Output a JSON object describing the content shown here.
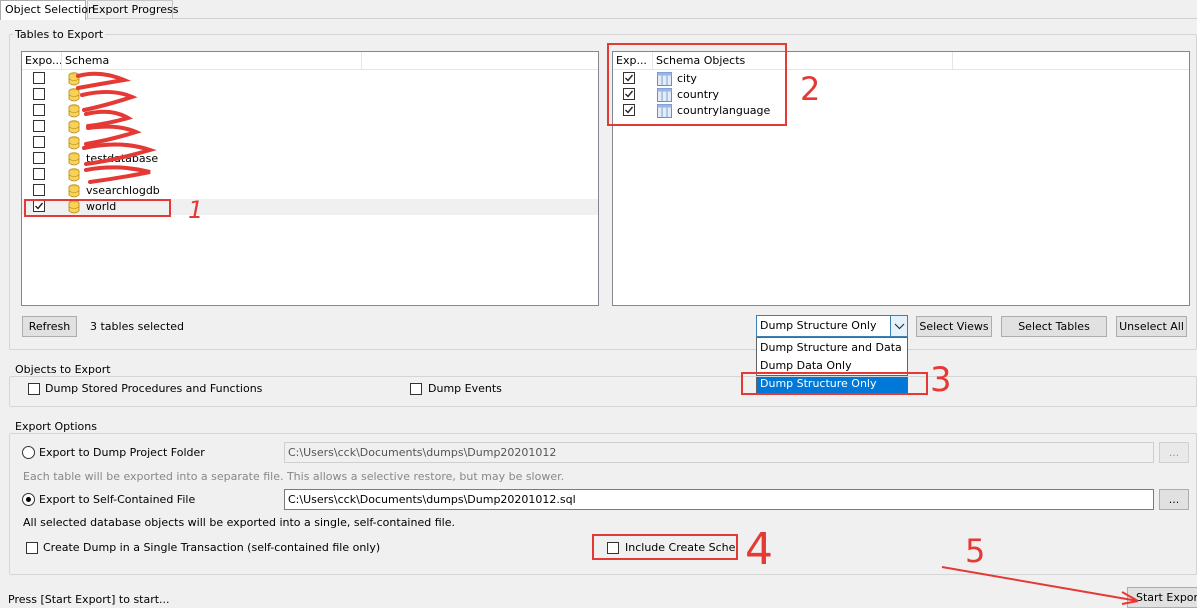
{
  "tabs": [
    {
      "label": "Object Selection",
      "active": true
    },
    {
      "label": "Export Progress",
      "active": false
    }
  ],
  "tables_group": {
    "title": "Tables to Export"
  },
  "schema_list": {
    "col_export": "Expo...",
    "col_schema": "Schema",
    "rows": [
      {
        "name": "",
        "checked": false
      },
      {
        "name": "",
        "checked": false
      },
      {
        "name": "",
        "checked": false
      },
      {
        "name": "",
        "checked": false
      },
      {
        "name": "",
        "checked": false
      },
      {
        "name": "testdatabase",
        "checked": false
      },
      {
        "name": "",
        "checked": false
      },
      {
        "name": "vsearchlogdb",
        "checked": false
      },
      {
        "name": "world",
        "checked": true
      }
    ]
  },
  "objects_list": {
    "col_export": "Exp...",
    "col_objects": "Schema Objects",
    "rows": [
      {
        "name": "city",
        "checked": true
      },
      {
        "name": "country",
        "checked": true
      },
      {
        "name": "countrylanguage",
        "checked": true
      }
    ]
  },
  "toolbar": {
    "refresh_label": "Refresh",
    "status_text": "3 tables selected",
    "dump_select_value": "Dump Structure Only",
    "dump_options": [
      "Dump Structure and Data",
      "Dump Data Only",
      "Dump Structure Only"
    ],
    "select_views_label": "Select Views",
    "select_tables_label": "Select Tables",
    "unselect_all_label": "Unselect All"
  },
  "objects_group": {
    "title": "Objects to Export",
    "dump_procedures_label": "Dump Stored Procedures and Functions",
    "dump_procedures_checked": false,
    "dump_events_label": "Dump Events",
    "dump_events_checked": false
  },
  "export_options": {
    "title": "Export Options",
    "folder_radio_label": "Export to Dump Project Folder",
    "folder_path": "C:\\Users\\cck\\Documents\\dumps\\Dump20201012",
    "folder_hint": "Each table will be exported into a separate file. This allows a selective restore, but may be slower.",
    "file_radio_label": "Export to Self-Contained File",
    "file_path": "C:\\Users\\cck\\Documents\\dumps\\Dump20201012.sql",
    "file_hint": "All selected database objects will be exported into a single, self-contained file.",
    "browse_label": "...",
    "single_transaction_label": "Create Dump in a Single Transaction (self-contained file only)",
    "single_transaction_checked": false,
    "include_schema_label": "Include Create Schema",
    "include_schema_checked": false,
    "selected": "file"
  },
  "footer": {
    "status": "Press [Start Export] to start...",
    "start_export_label": "Start Export"
  },
  "annotations": {
    "step1": "1",
    "step2": "2",
    "step3": "3",
    "step4": "4",
    "step5": "5",
    "color": "#e53935"
  }
}
